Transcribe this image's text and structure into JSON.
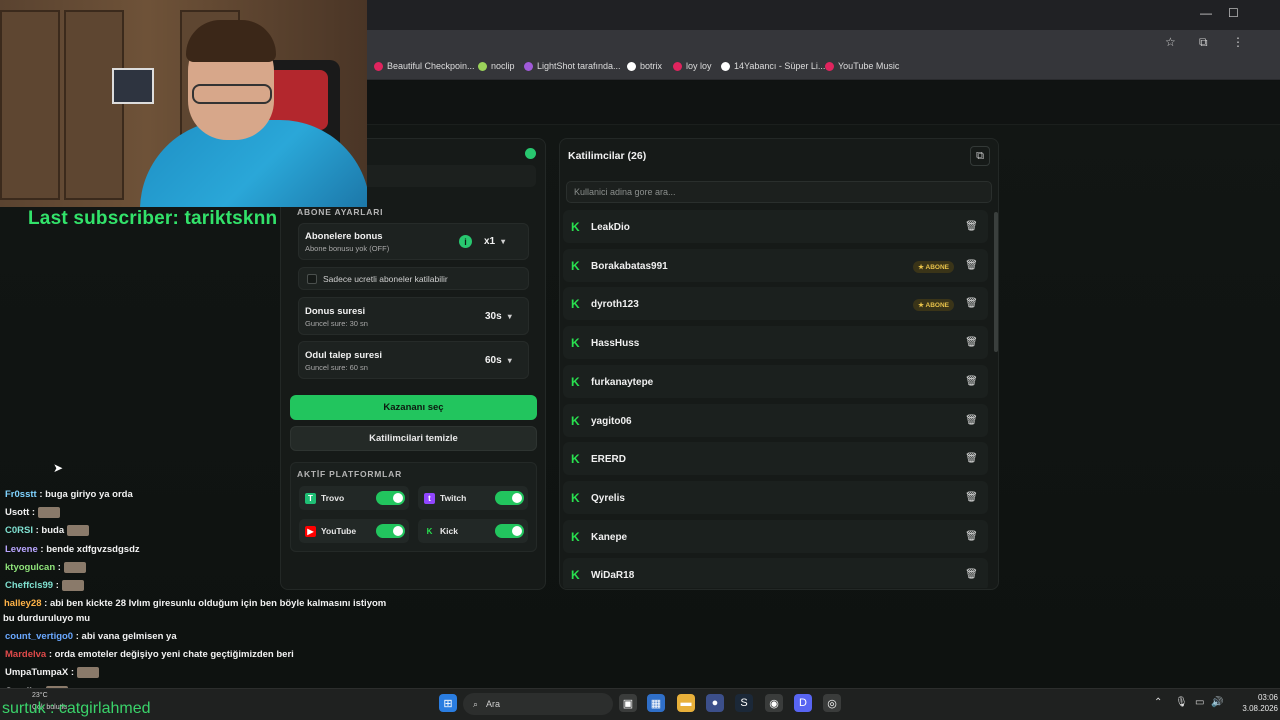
{
  "bookmarks": [
    {
      "label": "Beautiful Checkpoin...",
      "color": "#e0245e"
    },
    {
      "label": "noclip",
      "color": "#9bd35a"
    },
    {
      "label": "LightShot tarafında...",
      "color": "#a05ad8"
    },
    {
      "label": "botrix",
      "color": "#ffffff"
    },
    {
      "label": "loy loy",
      "color": "#e0245e"
    },
    {
      "label": "14Yabancı - Süper Li...",
      "color": "#ffffff"
    },
    {
      "label": "YouTube Music",
      "color": "#e0245e"
    }
  ],
  "overlay": {
    "last_subscriber": "Last subscriber: tariktsknn",
    "bottom_name": "surtuk : catgirlahmed"
  },
  "chat": [
    {
      "user": "Fr0sstt",
      "color": "#7fd3ff",
      "text": ": buga giriyo ya orda"
    },
    {
      "user": "Usott",
      "color": "#f2f2f2",
      "text": ":"
    },
    {
      "user": "C0RSI",
      "color": "#7fe0d0",
      "text": ": buda"
    },
    {
      "user": "Levene",
      "color": "#b9a6ff",
      "text": ": bende xdfgvzsdgsdz"
    },
    {
      "user": "ktyogulcan",
      "color": "#8fe37a",
      "text": ":"
    },
    {
      "user": "Cheffcls99",
      "color": "#7fe0d0",
      "text": ":"
    },
    {
      "user": "halley28",
      "color": "#ffb347",
      "text": ": abi ben kickte 28 Ivlım giresunlu olduğum için ben böyle kalmasını istiyom"
    },
    {
      "user": "",
      "color": "#f2f2f2",
      "text": "bu durduruluyo mu"
    },
    {
      "user": "count_vertigo0",
      "color": "#6aa8ff",
      "text": ": abi vana gelmisen ya"
    },
    {
      "user": "Mardelva",
      "color": "#e04a4a",
      "text": ": orda emoteler değişiyo yeni chate geçtiğimizden beri"
    },
    {
      "user": "UmpaTumpaX",
      "color": "#f2f2f2",
      "text": ":"
    },
    {
      "user": "Qyrelis",
      "color": "#f2f2f2",
      "text": ":"
    }
  ],
  "left_panel": {
    "abone_label": "ABONE AYARLARI",
    "bonus_title": "Abonelere bonus",
    "bonus_sub": "Abone bonusu yok (OFF)",
    "bonus_value": "x1",
    "only_paid": "Sadece ucretli aboneler katilabilir",
    "duration_title": "Donus suresi",
    "duration_sub": "Guncel sure: 30 sn",
    "duration_value": "30s",
    "claim_title": "Odul talep suresi",
    "claim_sub": "Guncel sure: 60 sn",
    "claim_value": "60s",
    "pick_winner": "Kazananı seç",
    "clear_participants": "Katilimcilari temizle",
    "platforms_label": "AKTİF PLATFORMLAR",
    "platforms": [
      {
        "name": "Trovo",
        "color": "#1fbf75",
        "on": true
      },
      {
        "name": "Twitch",
        "color": "#9146ff",
        "on": true
      },
      {
        "name": "YouTube",
        "color": "#ff0000",
        "on": true
      },
      {
        "name": "Kick",
        "color": "#28e04f",
        "on": true
      }
    ]
  },
  "right_panel": {
    "title": "Katilimcilar (26)",
    "search_placeholder": "Kullanici adina gore ara...",
    "participants": [
      {
        "name": "LeakDio",
        "badge": ""
      },
      {
        "name": "Borakabatas991",
        "badge": "★ ABONE"
      },
      {
        "name": "dyroth123",
        "badge": "★ ABONE"
      },
      {
        "name": "HassHuss",
        "badge": ""
      },
      {
        "name": "furkanaytepe",
        "badge": ""
      },
      {
        "name": "yagito06",
        "badge": ""
      },
      {
        "name": "ERERD",
        "badge": ""
      },
      {
        "name": "Qyrelis",
        "badge": ""
      },
      {
        "name": "Kanepe",
        "badge": ""
      },
      {
        "name": "WiDaR18",
        "badge": ""
      }
    ]
  },
  "taskbar": {
    "search": "Ara",
    "time": "03:06",
    "date": "3.08.2026",
    "weather": "23°C",
    "weather_sub": "Çok bulutlu"
  }
}
